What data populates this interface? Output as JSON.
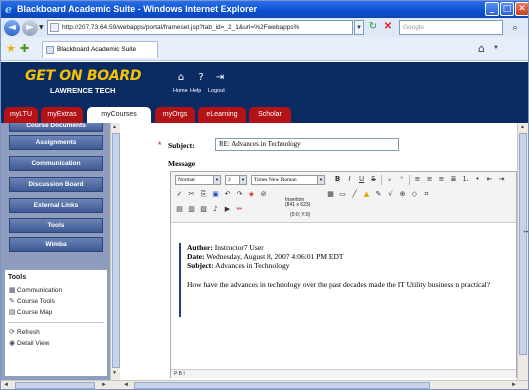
{
  "window": {
    "title": "Blackboard Academic Suite - Windows Internet Explorer",
    "minimize_glyph": "_",
    "maximize_glyph": "□",
    "close_glyph": "✕"
  },
  "addressbar": {
    "url": "http://207.73.64.59/webapps/portal/frameset.jsp?tab_id=_2_1&url=%2Fwebapps%",
    "search_placeholder": "Google"
  },
  "browser_tab": {
    "label": "Blackboard Academic Suite"
  },
  "bb_header": {
    "logo_line1": "GET ON BOARD",
    "logo_line2": "LAWRENCE TECH",
    "links": [
      "Home",
      "Help",
      "Logout"
    ]
  },
  "course_tabs": [
    {
      "label": "myLTU",
      "active": false
    },
    {
      "label": "myExtras",
      "active": false
    },
    {
      "label": "myCourses",
      "active": true
    },
    {
      "label": "myOrgs",
      "active": false
    },
    {
      "label": "eLearning",
      "active": false
    },
    {
      "label": "Scholar",
      "active": false
    }
  ],
  "left_menu": {
    "cut_item": "Course Documents",
    "items": [
      "Assignments",
      "Communication",
      "Discussion Board",
      "External Links",
      "Tools",
      "Wimba"
    ]
  },
  "tools_box": {
    "heading": "Tools",
    "items": [
      "Communication",
      "Course Tools",
      "Course Map"
    ],
    "actions": [
      "Refresh",
      "Detail View"
    ]
  },
  "form": {
    "subject_label": "Subject:",
    "subject_value": "RE: Advances in Technology",
    "message_label": "Message"
  },
  "editor": {
    "style_select": "Normal",
    "size_select": "2",
    "font_select": "Times New Roman",
    "coords_label": "Insertion",
    "coords_size": "(841 x 623)",
    "coords_pos": "(0:0; Y:0)",
    "status": "P  B  I"
  },
  "quoted_message": {
    "author_label": "Author:",
    "author_value": "Instructor7 User",
    "date_label": "Date:",
    "date_value": "Wednesday, August 8, 2007 4:06:01 PM EDT",
    "subject_label": "Subject:",
    "subject_value": "Advances in Technology",
    "body": "How have the advances in technology over the past decades made the IT Utility business n practical?"
  }
}
